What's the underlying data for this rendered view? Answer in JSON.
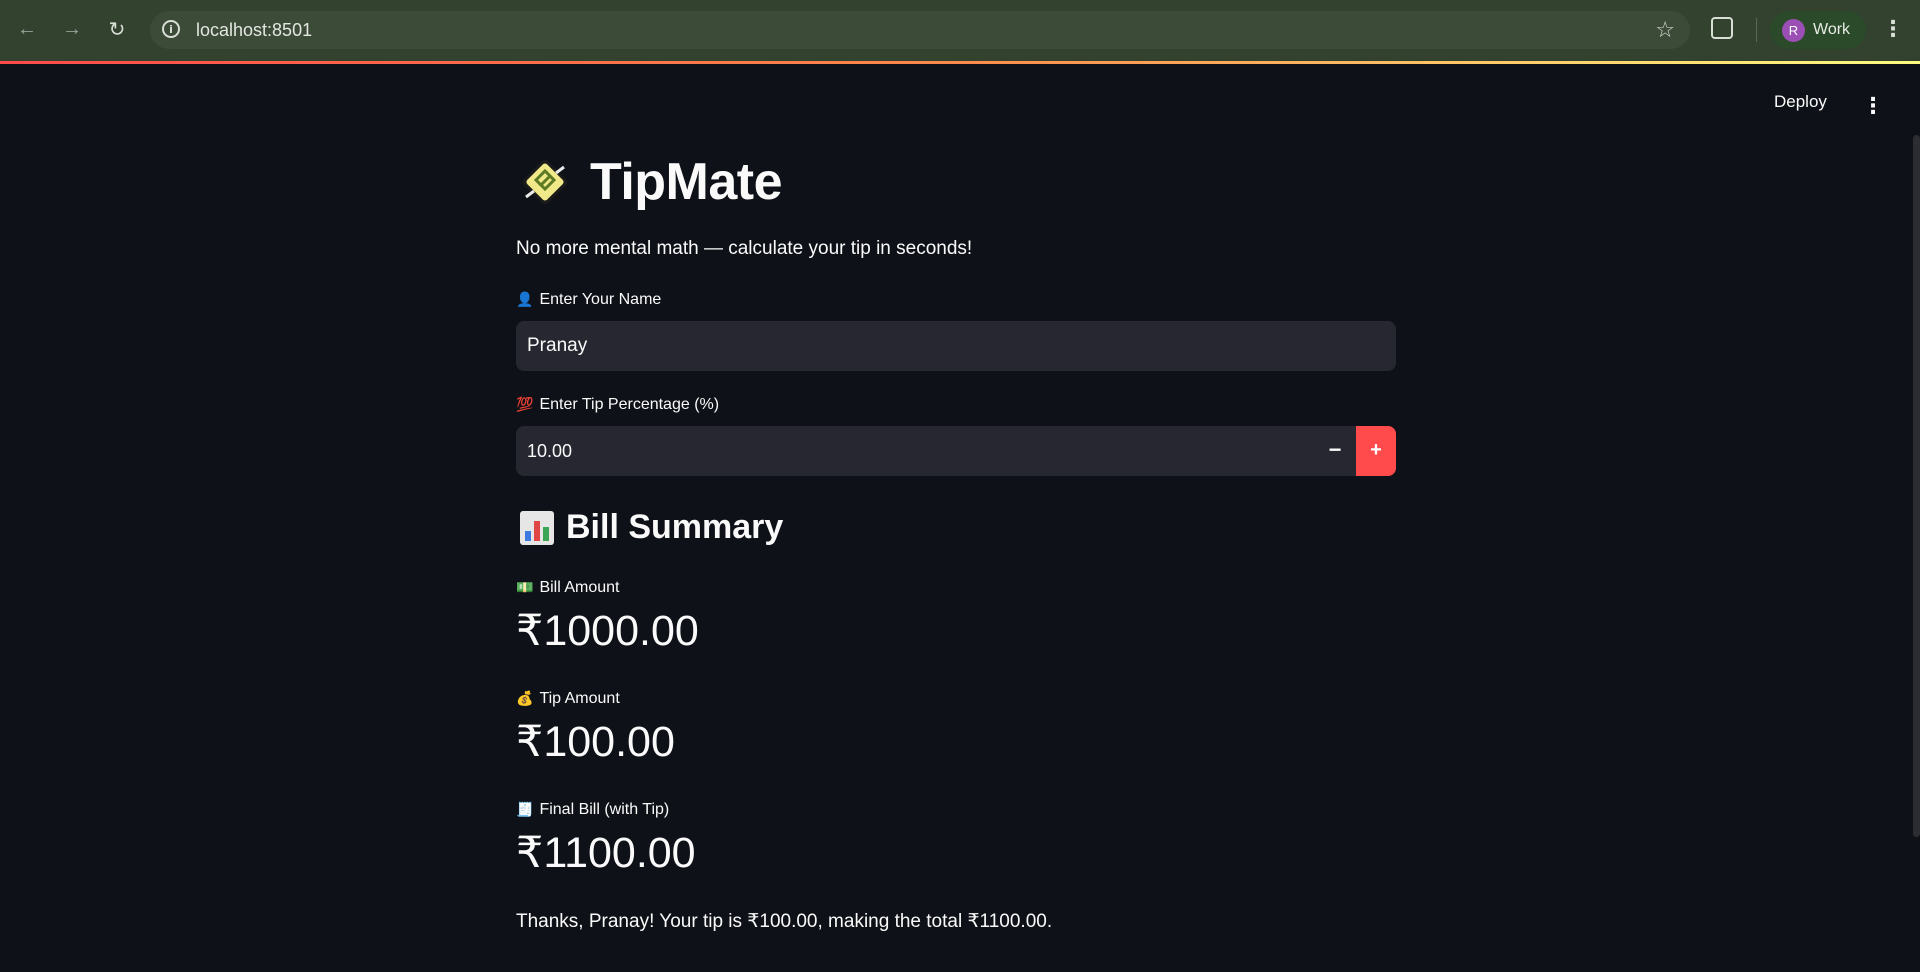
{
  "browser": {
    "url": "localhost:8501",
    "profile_initial": "R",
    "profile_label": "Work"
  },
  "header": {
    "deploy_label": "Deploy"
  },
  "app": {
    "title": "TipMate",
    "subtitle": "No more mental math — calculate your tip in seconds!",
    "name_field": {
      "emoji": "👤",
      "label": "Enter Your Name",
      "value": "Pranay"
    },
    "tip_field": {
      "emoji": "💯",
      "label": "Enter Tip Percentage (%)",
      "value": "10.00",
      "minus_label": "−",
      "plus_label": "+"
    },
    "summary": {
      "title": "Bill Summary",
      "bill": {
        "emoji": "💵",
        "label": "Bill Amount",
        "value": "₹1000.00"
      },
      "tip": {
        "emoji": "💰",
        "label": "Tip Amount",
        "value": "₹100.00"
      },
      "final": {
        "emoji": "🧾",
        "label": "Final Bill (with Tip)",
        "value": "₹1100.00"
      }
    },
    "thanks_message": "Thanks, Pranay! Your tip is ₹100.00, making the total ₹1100.00."
  },
  "colors": {
    "background": "#0e1117",
    "input_bg": "#262730",
    "accent": "#ff4b4b",
    "chrome": "#33412f"
  }
}
